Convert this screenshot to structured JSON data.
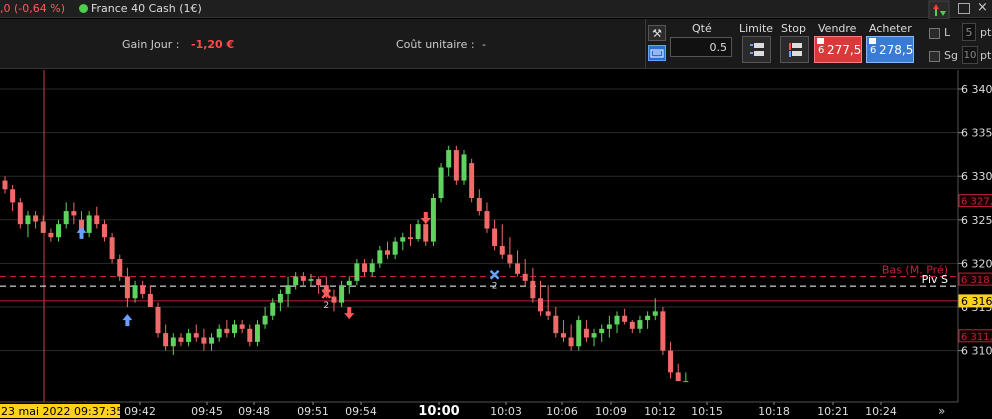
{
  "titlebar": {
    "change_text": ",0 (-0,64 %)",
    "instrument": "France 40 Cash (1€)",
    "close_glyph": "×"
  },
  "infobar": {
    "gain_label": "Gain Jour :",
    "gain_value": "-1,20 €",
    "cout_label": "Coût unitaire :",
    "cout_value": "-"
  },
  "trade": {
    "qty_label": "Qté",
    "qty_value": "0.5",
    "limite_label": "Limite",
    "stop_label": "Stop",
    "vendre_label": "Vendre",
    "acheter_label": "Acheter",
    "vendre_prefix": "6",
    "vendre_price": "277,5",
    "acheter_prefix": "6",
    "acheter_price": "278,5",
    "l_label": "L",
    "l_value": "5",
    "sg_label": "Sg",
    "sg_value": "10",
    "pts_label": "pts",
    "pts2_label": "pt",
    "colors": {
      "sell": "#d83a3a",
      "buy": "#3a7bd5"
    }
  },
  "chart_data": {
    "type": "candlestick",
    "instrument": "France 40 Cash (1€)",
    "ylim": [
      6306.5,
      6344
    ],
    "y_ticks": [
      "6 340",
      "6 335",
      "6 330",
      "6 325",
      "6 320",
      "6 315",
      "6 310"
    ],
    "y_tick_values": [
      6340,
      6335,
      6330,
      6325,
      6320,
      6315,
      6310
    ],
    "x_labels": [
      "23 mai 2022 09:37:35",
      "09:42",
      "09:45",
      "09:48",
      "09:51",
      "09:54",
      "10:00",
      "10:03",
      "10:06",
      "10:09",
      "10:12",
      "10:15",
      "10:18",
      "10:21",
      "10:24"
    ],
    "price_markers": [
      {
        "label": "6 327,",
        "value": 6327.2,
        "color": "#c0203a"
      },
      {
        "label": "6 318",
        "value": 6318.2,
        "color": "#c0203a"
      },
      {
        "label": "6 316",
        "value": 6315.7,
        "color": "#ffd21a"
      },
      {
        "label": "6 311,",
        "value": 6311.7,
        "color": "#c0203a"
      }
    ],
    "hlines": [
      {
        "label": "Bas (M. Pré)",
        "value": 6318.5,
        "style": "dashed",
        "color": "#c0203a"
      },
      {
        "label": "Piv S",
        "value": 6317.4,
        "style": "dashed",
        "color": "#ffffff"
      },
      {
        "label": "",
        "value": 6315.7,
        "style": "solid",
        "color": "#c0203a"
      }
    ],
    "annotations": [
      {
        "type": "arrow-up",
        "color": "#6aa0ff",
        "candle": 10,
        "value": 6323.5
      },
      {
        "type": "arrow-up",
        "color": "#6aa0ff",
        "candle": 16,
        "value": 6313.5
      },
      {
        "type": "cross",
        "color": "#ff5a5a",
        "candle": 42,
        "value": 6316.5,
        "label": "2"
      },
      {
        "type": "arrow-down",
        "color": "#ff5a5a",
        "candle": 45,
        "value": 6314.3
      },
      {
        "type": "arrow-down",
        "color": "#ff5a5a",
        "candle": 55,
        "value": 6325.2
      },
      {
        "type": "cross",
        "color": "#6aa0ff",
        "candle": 64,
        "value": 6318.7,
        "label": "2"
      }
    ],
    "candles": [
      [
        6329.5,
        6330,
        6328,
        6328.5
      ],
      [
        6328.5,
        6329,
        6326,
        6327
      ],
      [
        6327,
        6327.5,
        6324,
        6324.5
      ],
      [
        6324.5,
        6326,
        6323,
        6325.5
      ],
      [
        6325.5,
        6326,
        6324,
        6324.8
      ],
      [
        6324.8,
        6325.5,
        6323.5,
        6323.5
      ],
      [
        6323.5,
        6324,
        6322.5,
        6323
      ],
      [
        6323,
        6325,
        6322.5,
        6324.5
      ],
      [
        6324.5,
        6327,
        6324,
        6326
      ],
      [
        6326,
        6327,
        6324.5,
        6325.5
      ],
      [
        6325,
        6326,
        6323,
        6323.5
      ],
      [
        6323.5,
        6326,
        6323,
        6325.5
      ],
      [
        6325.5,
        6326.5,
        6324,
        6324.5
      ],
      [
        6324.5,
        6325,
        6322.5,
        6323
      ],
      [
        6323,
        6323.5,
        6320,
        6320.5
      ],
      [
        6320.5,
        6321,
        6318,
        6318.5
      ],
      [
        6318.5,
        6319.5,
        6315,
        6316
      ],
      [
        6316,
        6318,
        6315.5,
        6317.5
      ],
      [
        6317.5,
        6318,
        6316,
        6316.5
      ],
      [
        6316.5,
        6317.5,
        6315,
        6315
      ],
      [
        6315,
        6315.5,
        6311.5,
        6312
      ],
      [
        6312,
        6313,
        6310,
        6310.5
      ],
      [
        6310.5,
        6312,
        6309.5,
        6311.5
      ],
      [
        6311.5,
        6312,
        6310.5,
        6311
      ],
      [
        6311,
        6312.5,
        6310.5,
        6312
      ],
      [
        6312,
        6313,
        6311,
        6311.5
      ],
      [
        6311.5,
        6312.5,
        6310,
        6310.8
      ],
      [
        6310.8,
        6312,
        6310,
        6311.5
      ],
      [
        6311.5,
        6313,
        6311,
        6312.5
      ],
      [
        6312.5,
        6313.5,
        6311.5,
        6312
      ],
      [
        6312,
        6313.5,
        6311.5,
        6313
      ],
      [
        6313,
        6313.5,
        6312,
        6312.5
      ],
      [
        6312.5,
        6313,
        6310.5,
        6311
      ],
      [
        6311,
        6313.5,
        6310.5,
        6313
      ],
      [
        6313,
        6315,
        6312.5,
        6314
      ],
      [
        6314,
        6316,
        6313.5,
        6315.5
      ],
      [
        6315.5,
        6317,
        6314.5,
        6316.5
      ],
      [
        6316.5,
        6318.5,
        6315,
        6317.5
      ],
      [
        6317.5,
        6319,
        6317,
        6318.5
      ],
      [
        6318.5,
        6319,
        6317.5,
        6318
      ],
      [
        6318,
        6318.8,
        6317.5,
        6318.2
      ],
      [
        6318.2,
        6318.5,
        6316.5,
        6317.5
      ],
      [
        6317.5,
        6318.5,
        6316,
        6316.2
      ],
      [
        6316.2,
        6317,
        6314.5,
        6315.5
      ],
      [
        6315.5,
        6318,
        6315,
        6317.5
      ],
      [
        6317.5,
        6318.5,
        6316.5,
        6318
      ],
      [
        6318,
        6320.5,
        6317.5,
        6320
      ],
      [
        6320,
        6320.5,
        6318.5,
        6319
      ],
      [
        6319,
        6320.5,
        6318.5,
        6320
      ],
      [
        6320,
        6322,
        6319.5,
        6321.5
      ],
      [
        6321.5,
        6322.5,
        6320.5,
        6321
      ],
      [
        6321,
        6323,
        6320.5,
        6322.5
      ],
      [
        6322.5,
        6323.5,
        6321.5,
        6323
      ],
      [
        6323,
        6324.5,
        6322,
        6322.8
      ],
      [
        6322.8,
        6325,
        6322.5,
        6324.5
      ],
      [
        6324.5,
        6325.5,
        6322,
        6322.5
      ],
      [
        6322.5,
        6328,
        6322,
        6327.5
      ],
      [
        6327.5,
        6331.5,
        6327,
        6331
      ],
      [
        6331,
        6333.5,
        6330,
        6333
      ],
      [
        6333,
        6333.5,
        6329,
        6329.5
      ],
      [
        6329.5,
        6333,
        6329,
        6332.5
      ],
      [
        6331.5,
        6332,
        6327,
        6327.5
      ],
      [
        6327.5,
        6328.5,
        6325.5,
        6326
      ],
      [
        6326,
        6327,
        6323.5,
        6324
      ],
      [
        6324,
        6325,
        6321.5,
        6322
      ],
      [
        6322,
        6324.5,
        6320.5,
        6321
      ],
      [
        6321,
        6323,
        6319.5,
        6320
      ],
      [
        6320,
        6321.5,
        6318.5,
        6318.8
      ],
      [
        6318.8,
        6320.5,
        6317.5,
        6318
      ],
      [
        6318,
        6319.5,
        6315.5,
        6316
      ],
      [
        6316,
        6318,
        6314,
        6314.5
      ],
      [
        6314.5,
        6317.5,
        6313.5,
        6314
      ],
      [
        6314,
        6315,
        6311.5,
        6312
      ],
      [
        6312,
        6313.5,
        6311,
        6311.5
      ],
      [
        6311.5,
        6313,
        6310,
        6310.5
      ],
      [
        6310.5,
        6314,
        6310,
        6313.5
      ],
      [
        6312.5,
        6313.5,
        6311,
        6311.5
      ],
      [
        6311.5,
        6312.5,
        6310.5,
        6312
      ],
      [
        6312,
        6313,
        6311,
        6312.5
      ],
      [
        6312.5,
        6314,
        6311.5,
        6313
      ],
      [
        6313,
        6314.5,
        6312,
        6314
      ],
      [
        6314,
        6314.8,
        6313,
        6313.3
      ],
      [
        6313.3,
        6313.5,
        6312,
        6312.5
      ],
      [
        6312.5,
        6314,
        6312,
        6313.5
      ],
      [
        6313.5,
        6314.5,
        6312.5,
        6314
      ],
      [
        6314,
        6316,
        6313.5,
        6314.5
      ],
      [
        6314.5,
        6315,
        6309.5,
        6310
      ],
      [
        6310,
        6311,
        6306.8,
        6307.5
      ],
      [
        6307.5,
        6308.5,
        6306.5,
        6306.5
      ],
      [
        6306.5,
        6307.5,
        6306.5,
        6306.5
      ]
    ]
  }
}
